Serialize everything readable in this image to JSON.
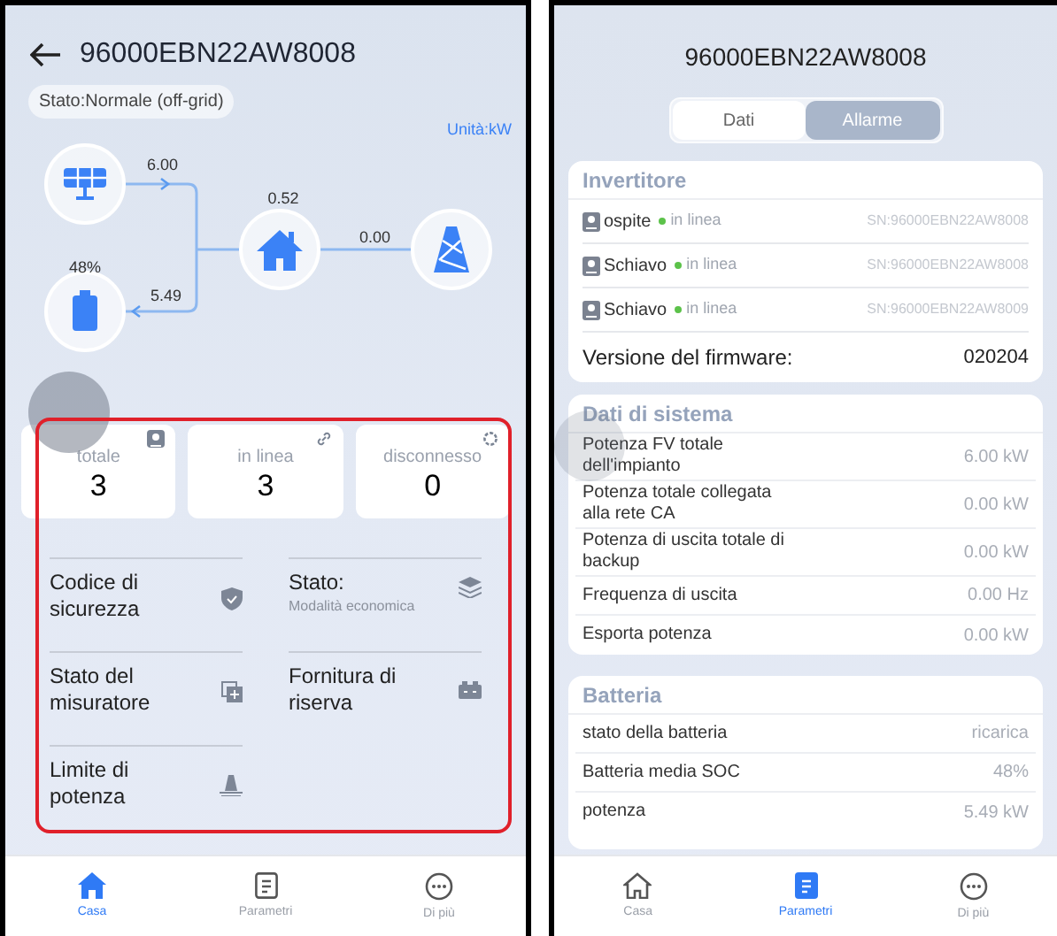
{
  "left_screen": {
    "title": "96000EBN22AW8008",
    "status": "Stato:Normale (off-grid)",
    "unit": "Unità:kW",
    "flow": {
      "solar_power": "6.00",
      "battery_soc": "48%",
      "battery_power": "5.49",
      "home_power": "0.52",
      "grid_power": "0.00"
    },
    "stats": [
      {
        "label": "totale",
        "value": "3"
      },
      {
        "label": "in linea",
        "value": "3"
      },
      {
        "label": "disconnesso",
        "value": "0"
      }
    ],
    "menu": [
      {
        "label": "Codice di sicurezza"
      },
      {
        "label": "Stato:",
        "sublabel": "Modalità economica"
      },
      {
        "label": "Stato del misuratore"
      },
      {
        "label": "Fornitura di riserva"
      },
      {
        "label": "Limite di potenza"
      }
    ],
    "nav": [
      {
        "label": "Casa",
        "selected": true
      },
      {
        "label": "Parametri",
        "selected": false
      },
      {
        "label": "Di più",
        "selected": false
      }
    ]
  },
  "right_screen": {
    "title": "96000EBN22AW8008",
    "tabs": [
      {
        "label": "Dati",
        "selected": true
      },
      {
        "label": "Allarme",
        "selected": false
      }
    ],
    "inverter": {
      "title": "Invertitore",
      "devices": [
        {
          "role": "ospite",
          "status": "in linea",
          "online": true,
          "serial": "SN:96000EBN22AW8008"
        },
        {
          "role": "Schiavo",
          "status": "in linea",
          "online": true,
          "serial": "SN:96000EBN22AW8008"
        },
        {
          "role": "Schiavo",
          "status": "in linea",
          "online": true,
          "serial": "SN:96000EBN22AW8009"
        }
      ],
      "firmware_label": "Versione del firmware:",
      "firmware_value": "020204"
    },
    "system": {
      "title": "Dati di sistema",
      "rows": [
        {
          "label": "Potenza FV totale dell'impianto",
          "value": "6.00 kW"
        },
        {
          "label": "Potenza totale collegata alla rete CA",
          "value": "0.00 kW"
        },
        {
          "label": "Potenza di uscita totale di backup",
          "value": "0.00 kW"
        },
        {
          "label": "Frequenza di uscita",
          "value": "0.00 Hz"
        },
        {
          "label": "Esporta potenza",
          "value": "0.00 kW"
        }
      ]
    },
    "battery": {
      "title": "Batteria",
      "rows": [
        {
          "label": "stato della batteria",
          "value": "ricarica"
        },
        {
          "label": "Batteria media SOC",
          "value": "48%"
        },
        {
          "label": "potenza",
          "value": "5.49 kW"
        }
      ]
    },
    "nav": [
      {
        "label": "Casa",
        "selected": false
      },
      {
        "label": "Parametri",
        "selected": true
      },
      {
        "label": "Di più",
        "selected": false
      }
    ]
  }
}
